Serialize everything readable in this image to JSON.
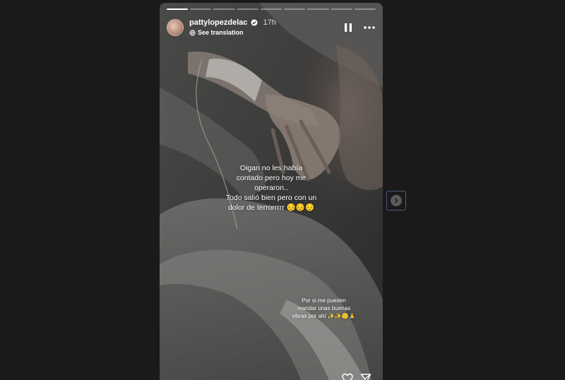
{
  "story": {
    "username": "pattylopezdelac",
    "time": "17h",
    "translation_label": "See translation",
    "progress": {
      "segments": 9,
      "current_fill": 1.0,
      "active_index": 0
    },
    "caption_main": [
      "Oigan no les había",
      "contado pero hoy me",
      "operaron..",
      "Todo salió bien pero con un",
      "dolor de terrorrrrr 😔😔😔"
    ],
    "caption_small": [
      "Por si me pueden",
      "mandar unas buenas",
      "vibras por ahí ✨✨🙂🙏"
    ]
  },
  "icons": {
    "verified": "verified-badge-icon",
    "translate": "globe-icon",
    "pause": "pause-icon",
    "more": "more-options-icon",
    "next": "chevron-right-icon",
    "like": "heart-icon",
    "share": "send-icon"
  },
  "colors": {
    "background": "#1a1a1a",
    "next_button_border": "#4a5a7a"
  }
}
